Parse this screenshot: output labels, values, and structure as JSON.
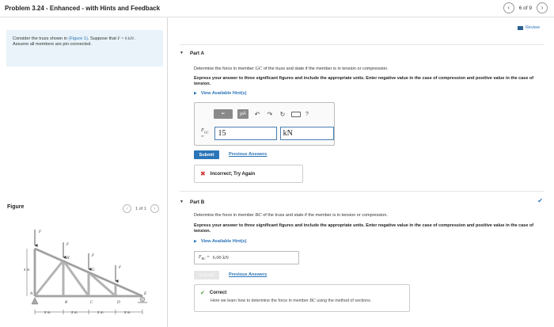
{
  "header": {
    "title": "Problem 3.24 - Enhanced - with Hints and Feedback",
    "page_count": "6 of 9",
    "prev_icon": "chevron-left-icon",
    "next_icon": "chevron-right-icon"
  },
  "problem": {
    "text_1": "Consider the truss shown in",
    "figure_link": "(Figure 1)",
    "text_2": ". Suppose that",
    "force_var": "F",
    "force_value": " = 6 kN .",
    "text_3": "Assume all members are pin connected."
  },
  "figure": {
    "label": "Figure",
    "count": "1 of 1",
    "labels": {
      "F": "F",
      "H": "H",
      "G": "G",
      "A": "A",
      "B": "B",
      "C": "C",
      "D": "D",
      "E": "E",
      "height": "4 m",
      "spacing": "2 m"
    }
  },
  "review": {
    "label": "Review"
  },
  "part_a": {
    "title": "Part A",
    "prompt_1": "Determine the force in member",
    "member": "GC",
    "prompt_2": "of the truss and state if the member is in tension or compression.",
    "instructions": "Express your answer to three significant figures and include the appropriate units. Enter negative value in the case of compression and positive value in the case of tension.",
    "hints_label": "View Available Hint(s)",
    "toolbar": {
      "templates_label": "▪▫",
      "mu_label": "μA",
      "undo_icon": "undo-icon",
      "redo_icon": "redo-icon",
      "reset_icon": "reset-icon",
      "keyboard_icon": "keyboard-icon",
      "help_label": "?"
    },
    "field_label": "F",
    "field_sub": "GC",
    "field_eq": " =",
    "value": "15",
    "unit": "kN",
    "submit_label": "Submit",
    "previous_answers_label": "Previous Answers",
    "feedback": "Incorrect; Try Again"
  },
  "part_b": {
    "title": "Part B",
    "prompt_1": "Determine the force in member",
    "member": "BC",
    "prompt_2": "of the truss and state if the member is in tension or compression.",
    "instructions": "Express your answer to three significant figures and include the appropriate units. Enter negative value in the case of compression and positive value in the case of tension.",
    "hints_label": "View Available Hint(s)",
    "answer_label": "F",
    "answer_sub": "BC",
    "answer_eq": " =",
    "answer_value": "6.00 kN",
    "submit_label": "Submit",
    "previous_answers_label": "Previous Answers",
    "feedback_title": "Correct",
    "feedback_text_1": "Here we learn how to determine the force in member",
    "feedback_member": "BC",
    "feedback_text_2": "using the method of sections."
  },
  "colors": {
    "accent": "#2b75b8",
    "error": "#d0312d",
    "success": "#4a9e3a",
    "problem_bg": "#e9f3f9"
  }
}
